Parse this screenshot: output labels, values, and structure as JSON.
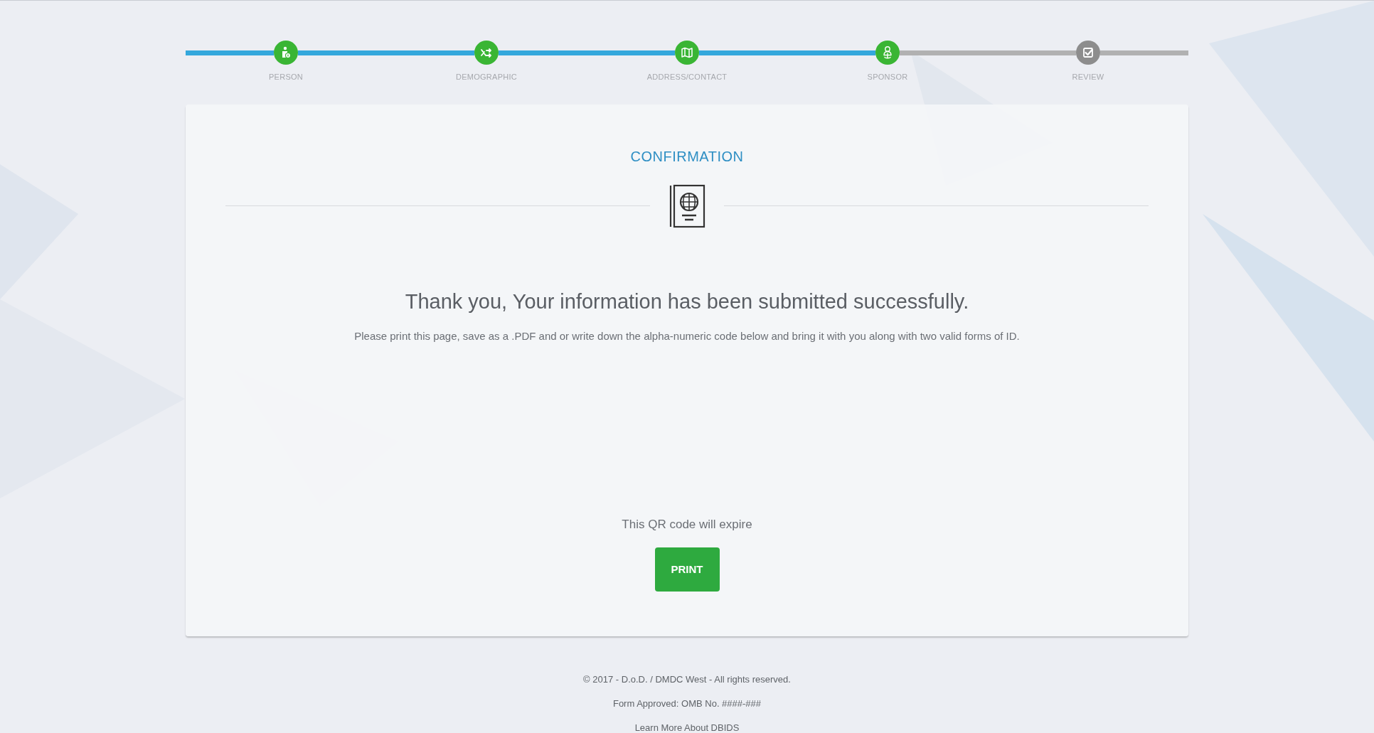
{
  "steps": [
    {
      "label": "PERSON",
      "completed": true
    },
    {
      "label": "DEMOGRAPHIC",
      "completed": true
    },
    {
      "label": "ADDRESS/CONTACT",
      "completed": true
    },
    {
      "label": "SPONSOR",
      "completed": true
    },
    {
      "label": "REVIEW",
      "completed": false
    }
  ],
  "card": {
    "title": "CONFIRMATION",
    "heading": "Thank you, Your information has been submitted successfully.",
    "instructions": "Please print this page, save as a .PDF and or write down the alpha-numeric code below and bring it with you along with two valid forms of ID.",
    "qr_note": "This QR code will expire",
    "print_button": "PRINT"
  },
  "footer": [
    "© 2017 - D.o.D. / DMDC West - All rights reserved.",
    "Form Approved: OMB No. ####-###",
    "Learn More About DBIDS"
  ]
}
